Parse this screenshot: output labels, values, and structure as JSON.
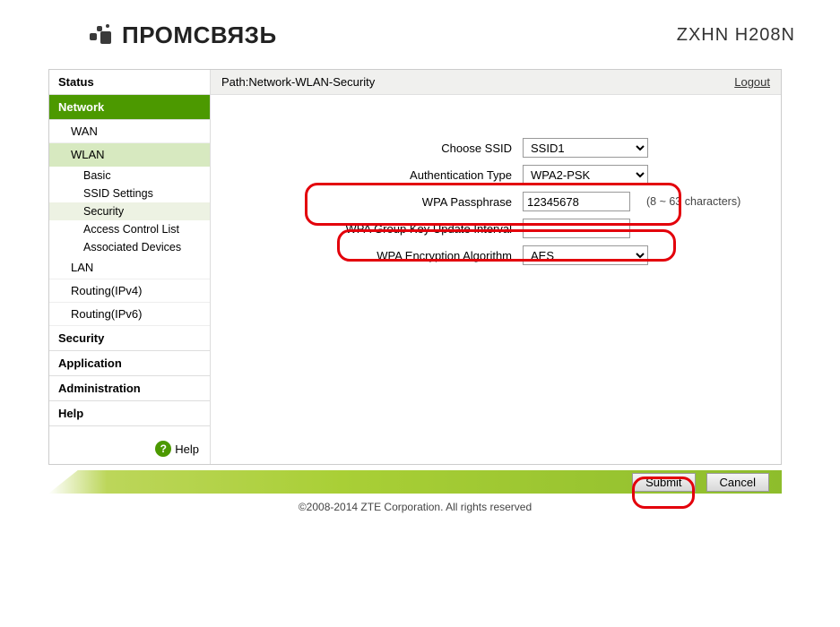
{
  "branding": {
    "logo_text": "ПРОМСВЯЗЬ",
    "model": "ZXHN H208N"
  },
  "breadcrumb": {
    "prefix": "Path:",
    "path": "Network-WLAN-Security",
    "logout": "Logout"
  },
  "sidebar": {
    "status": "Status",
    "network": "Network",
    "network_children": {
      "wan": "WAN",
      "wlan": "WLAN",
      "wlan_children": {
        "basic": "Basic",
        "ssid_settings": "SSID Settings",
        "security": "Security",
        "acl": "Access Control List",
        "assoc": "Associated Devices"
      },
      "lan": "LAN",
      "routing4": "Routing(IPv4)",
      "routing6": "Routing(IPv6)"
    },
    "security": "Security",
    "application": "Application",
    "administration": "Administration",
    "help": "Help",
    "help_link": "Help"
  },
  "form": {
    "choose_ssid": {
      "label": "Choose SSID",
      "value": "SSID1"
    },
    "auth_type": {
      "label": "Authentication Type",
      "value": "WPA2-PSK"
    },
    "passphrase": {
      "label": "WPA Passphrase",
      "value": "12345678",
      "hint": "(8 ~ 63 characters)"
    },
    "group_key": {
      "label": "WPA Group Key Update Interval",
      "value": ""
    },
    "encryption": {
      "label": "WPA Encryption Algorithm",
      "value": "AES"
    }
  },
  "buttons": {
    "submit": "Submit",
    "cancel": "Cancel"
  },
  "copyright": "©2008-2014 ZTE Corporation. All rights reserved"
}
